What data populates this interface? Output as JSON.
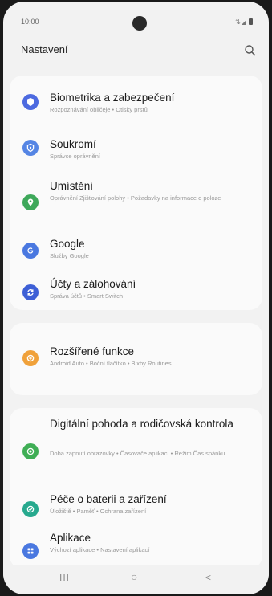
{
  "status": {
    "time": "10:00",
    "signal": "⇅◢"
  },
  "header": {
    "title": "Nastavení"
  },
  "groups": [
    {
      "items": [
        {
          "label": "Biometrika a zabezpečení",
          "sub": "Rozpoznávání obličeje  •  Otisky prstů",
          "icon": "shield-icon",
          "color": "#4d6ae0"
        },
        {
          "label": "Soukromí",
          "sub": "Správce oprávnění",
          "icon": "privacy-shield-icon",
          "color": "#5585e4"
        },
        {
          "label": "Umístění",
          "sub": "Oprávnění Zjišťování polohy  •  Požadavky na informace o poloze",
          "icon": "location-pin-icon",
          "color": "#3ea85a"
        },
        {
          "label": "Google",
          "sub": "Služby Google",
          "icon": "google-icon",
          "color": "#4a78e0"
        },
        {
          "label": "Účty a zálohování",
          "sub": "Správa účtů  •  Smart Switch",
          "icon": "sync-icon",
          "color": "#3d5fd6"
        }
      ]
    },
    {
      "items": [
        {
          "label": "Rozšířené funkce",
          "sub": "Android Auto  •  Boční tlačítko  •  Bixby Routines",
          "icon": "gear-plus-icon",
          "color": "#f0a13a"
        }
      ]
    },
    {
      "items": [
        {
          "label": "Digitální pohoda a rodičovská kontrola",
          "sub": "Doba zapnutí obrazovky  •  Časovače aplikací  •  Režim Čas spánku",
          "icon": "wellbeing-icon",
          "color": "#3fae55"
        },
        {
          "label": "Péče o baterii a zařízení",
          "sub": "Úložiště  •  Paměť  •  Ochrana zařízení",
          "icon": "device-care-icon",
          "color": "#27a98e"
        },
        {
          "label": "Aplikace",
          "sub": "Výchozí aplikace  •  Nastavení aplikací",
          "icon": "apps-grid-icon",
          "color": "#4a78e0"
        }
      ]
    }
  ],
  "nav": {
    "recents": "III",
    "home": "○",
    "back": "<"
  }
}
